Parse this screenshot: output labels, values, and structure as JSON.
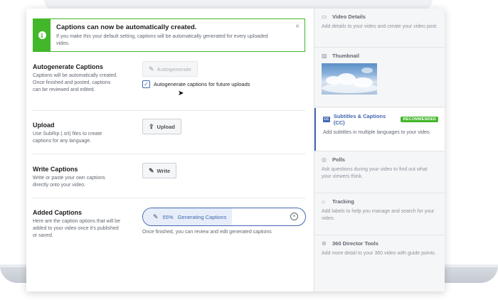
{
  "notice": {
    "title": "Captions can now be automatically created.",
    "text": "If you make this your default setting, captions will be automatically generated for every uploaded video.",
    "close": "×"
  },
  "sections": {
    "autogenerate": {
      "title": "Autogenerate Captions",
      "desc": "Captions will be automatically created. Once finished and posted, captions can be reviewed and edited.",
      "button_label": "Autogenerate",
      "checkbox_label": "Autogenerate captions for future uploads",
      "checkbox_checked": true
    },
    "upload": {
      "title": "Upload",
      "desc": "Use SubRip (.srt) files to create captions for any language.",
      "button_label": "Upload"
    },
    "write": {
      "title": "Write Captions",
      "desc": "Write or paste your own captions directly onto your video.",
      "button_label": "Write"
    },
    "added": {
      "title": "Added Captions",
      "desc": "Here are the caption options that will be added to your video once it's published or saved.",
      "progress_percent": "55%",
      "progress_value": 0.55,
      "progress_label": "Generating Captions",
      "note": "Once finished, you can review and edit generated captions"
    }
  },
  "sidebar": {
    "items": [
      {
        "title": "Video Details",
        "desc": "Add details to your video and create your video post.",
        "icon": "video-icon"
      },
      {
        "title": "Thumbnail",
        "desc": "",
        "icon": "image-icon"
      },
      {
        "title": "Subtitles & Captions (CC)",
        "badge": "RECOMMENDED",
        "desc": "Add subtitles in multiple languages to your video.",
        "icon": "cc-icon"
      },
      {
        "title": "Polls",
        "desc": "Ask questions during your video to find out what your viewers think.",
        "icon": "poll-icon"
      },
      {
        "title": "Tracking",
        "desc": "Add labels to help you manage and search for your video.",
        "icon": "tag-icon"
      },
      {
        "title": "360 Director Tools",
        "desc": "Add more detail to your 360 video with guide points.",
        "icon": "360-icon"
      }
    ]
  },
  "colors": {
    "accent": "#4267b2",
    "success": "#42b72a"
  }
}
